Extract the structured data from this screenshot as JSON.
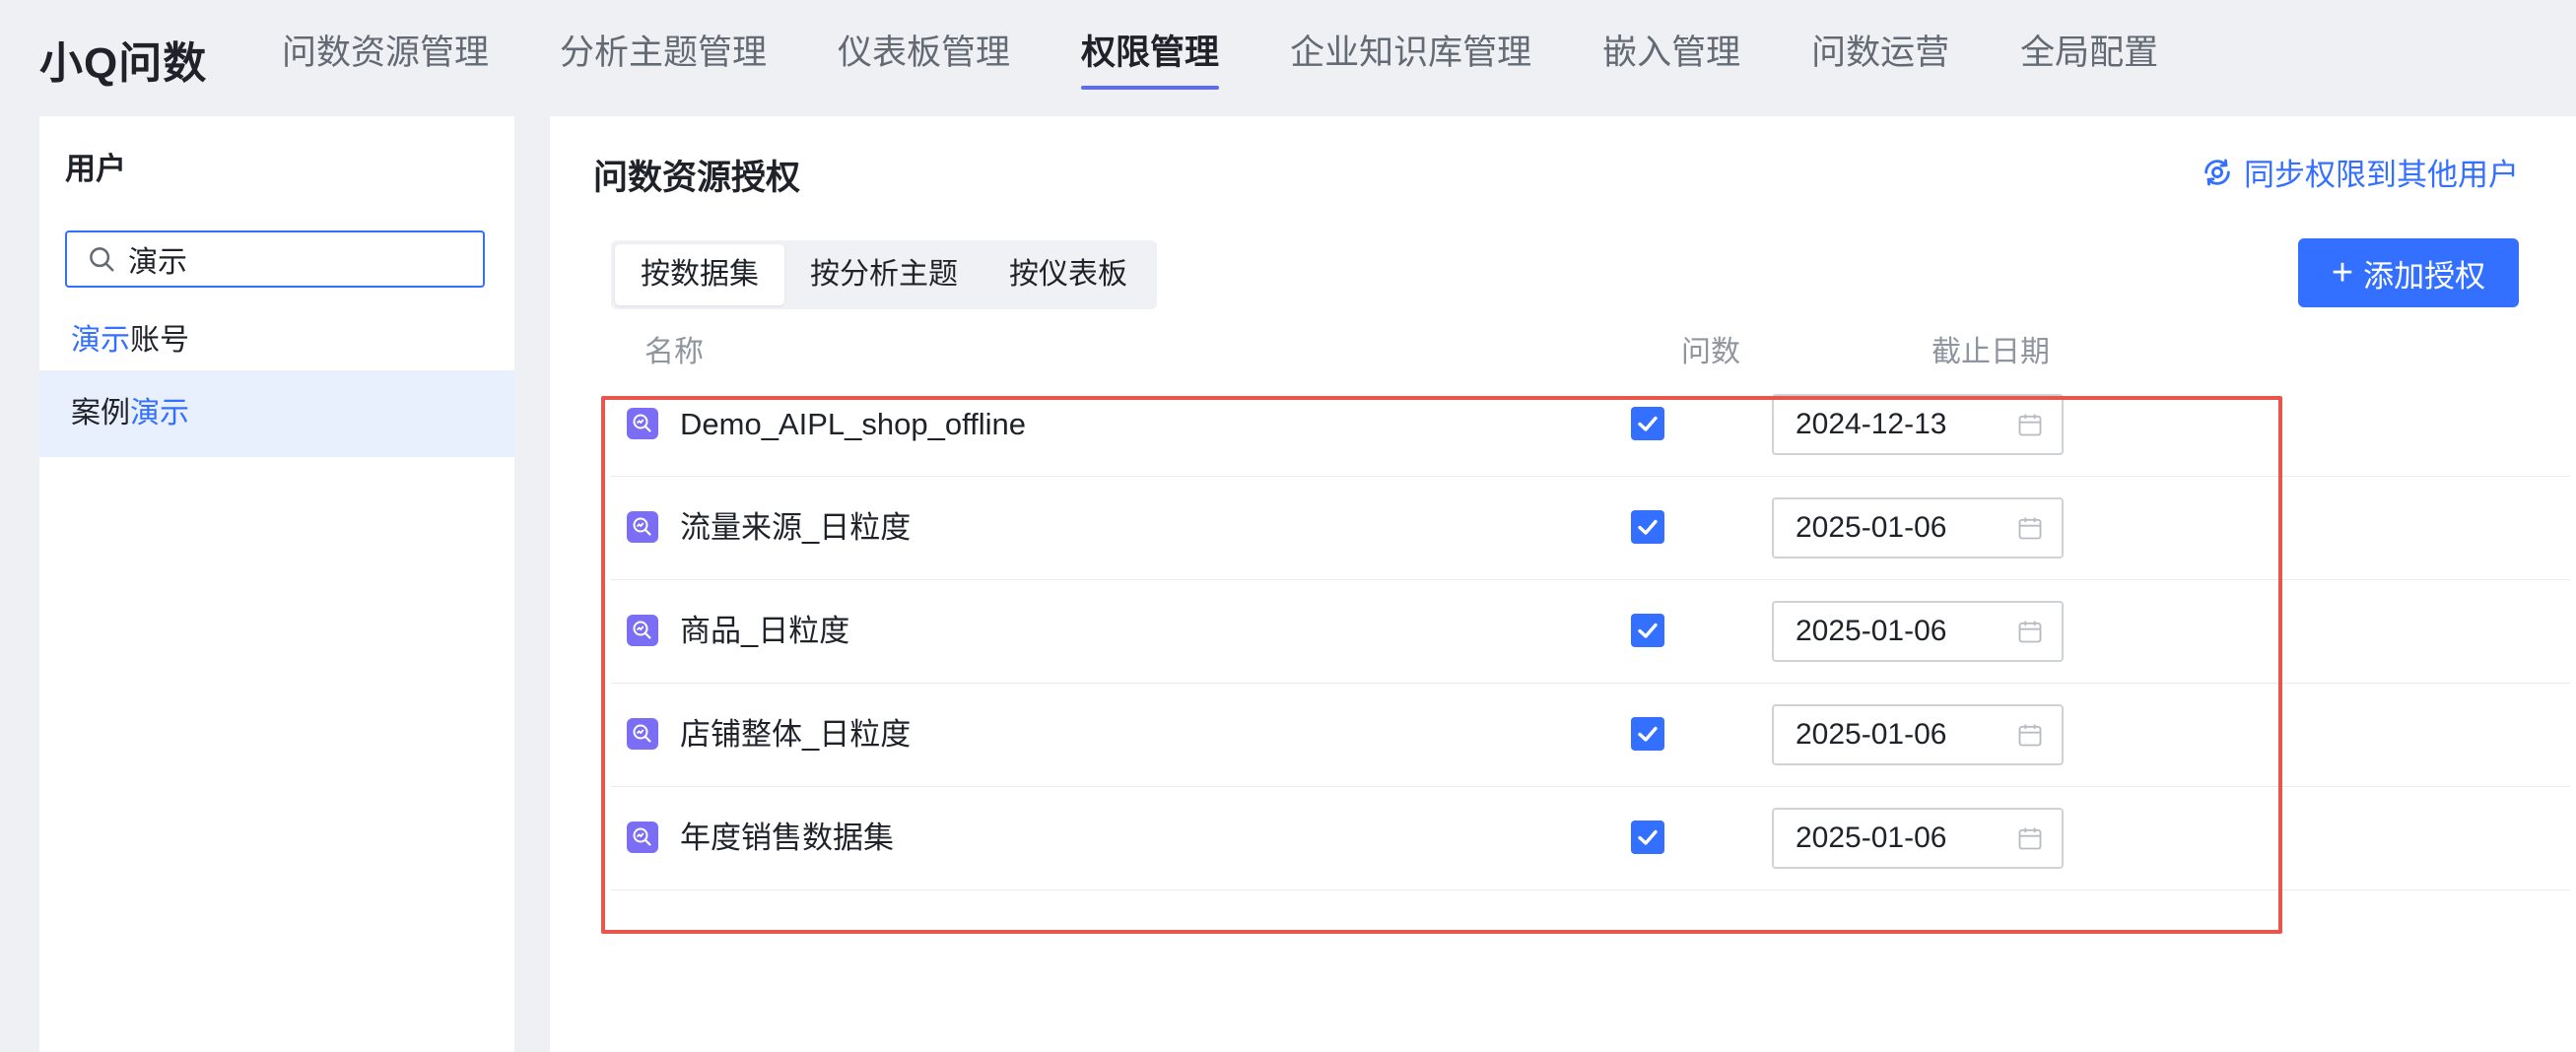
{
  "app": {
    "brand": "小Q问数"
  },
  "nav": {
    "items": [
      {
        "label": "问数资源管理"
      },
      {
        "label": "分析主题管理"
      },
      {
        "label": "仪表板管理"
      },
      {
        "label": "权限管理",
        "active": true
      },
      {
        "label": "企业知识库管理"
      },
      {
        "label": "嵌入管理"
      },
      {
        "label": "问数运营"
      },
      {
        "label": "全局配置"
      }
    ]
  },
  "user_panel": {
    "title": "用户",
    "search": {
      "value": "演示"
    },
    "users": [
      {
        "plain": "账号",
        "match": "演示",
        "match_first": true
      },
      {
        "plain": "案例",
        "match": "演示",
        "match_first": false,
        "selected": true
      }
    ]
  },
  "main": {
    "title": "问数资源授权",
    "sync_label": "同步权限到其他用户",
    "tabs": [
      {
        "label": "按数据集",
        "active": true
      },
      {
        "label": "按分析主题"
      },
      {
        "label": "按仪表板"
      }
    ],
    "add_button": "添加授权",
    "columns": {
      "name": "名称",
      "ask": "问数",
      "deadline": "截止日期"
    },
    "rows": [
      {
        "name": "Demo_AIPL_shop_offline",
        "ask_checked": true,
        "deadline": "2024-12-13"
      },
      {
        "name": "流量来源_日粒度",
        "ask_checked": true,
        "deadline": "2025-01-06"
      },
      {
        "name": "商品_日粒度",
        "ask_checked": true,
        "deadline": "2025-01-06"
      },
      {
        "name": "店铺整体_日粒度",
        "ask_checked": true,
        "deadline": "2025-01-06"
      },
      {
        "name": "年度销售数据集",
        "ask_checked": true,
        "deadline": "2025-01-06"
      }
    ]
  },
  "colors": {
    "accent": "#3370ff",
    "nav_underline": "#5b6cf0",
    "highlight_border": "#e9554a",
    "dataset_icon": "#7b6ef5",
    "selected_row_bg": "#e8f0fe"
  },
  "icons": {
    "search": "search-icon",
    "sync": "sync-eye-icon",
    "dataset": "dataset-icon",
    "calendar": "calendar-icon",
    "check": "check-icon"
  }
}
